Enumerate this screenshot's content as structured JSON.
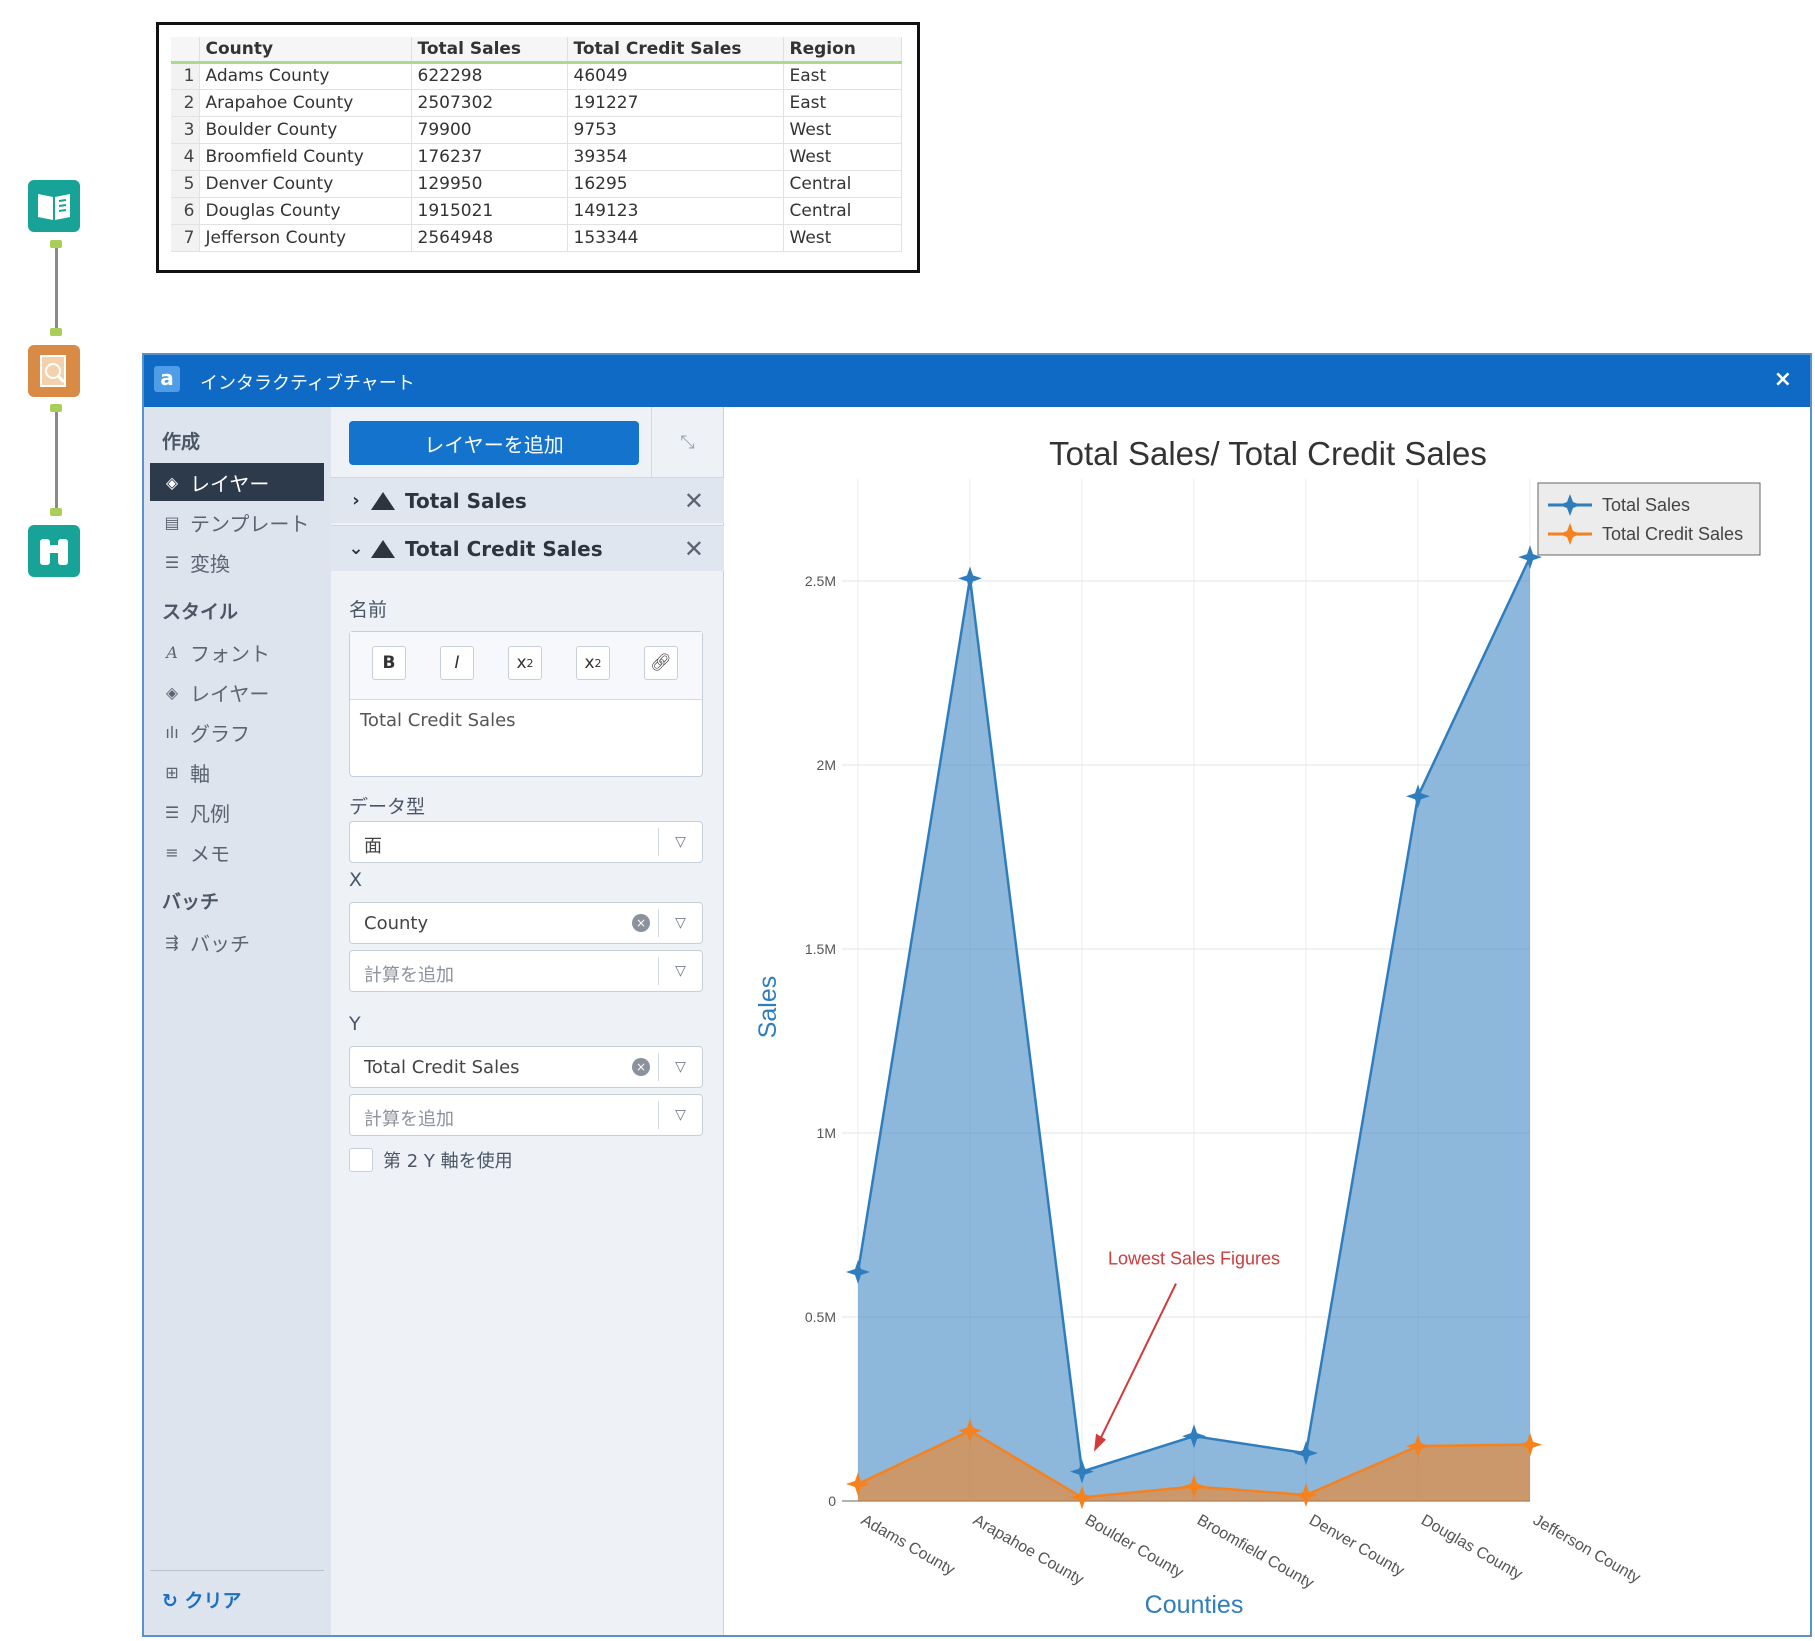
{
  "table": {
    "headers": [
      "County",
      "Total Sales",
      "Total Credit Sales",
      "Region"
    ],
    "rows": [
      {
        "n": "1",
        "county": "Adams County",
        "sales": "622298",
        "credit": "46049",
        "region": "East"
      },
      {
        "n": "2",
        "county": "Arapahoe County",
        "sales": "2507302",
        "credit": "191227",
        "region": "East"
      },
      {
        "n": "3",
        "county": "Boulder County",
        "sales": "79900",
        "credit": "9753",
        "region": "West"
      },
      {
        "n": "4",
        "county": "Broomfield County",
        "sales": "176237",
        "credit": "39354",
        "region": "West"
      },
      {
        "n": "5",
        "county": "Denver County",
        "sales": "129950",
        "credit": "16295",
        "region": "Central"
      },
      {
        "n": "6",
        "county": "Douglas County",
        "sales": "1915021",
        "credit": "149123",
        "region": "Central"
      },
      {
        "n": "7",
        "county": "Jefferson County",
        "sales": "2564948",
        "credit": "153344",
        "region": "West"
      }
    ]
  },
  "workflow": {
    "tools": [
      {
        "name": "input-data-tool",
        "color": "#17a398"
      },
      {
        "name": "interactive-chart-tool",
        "color": "#d98b45"
      },
      {
        "name": "browse-tool",
        "color": "#17a398"
      }
    ]
  },
  "dialog": {
    "logo": "a",
    "title": "インタラクティブチャート",
    "close": "×"
  },
  "nav": {
    "section_create": "作成",
    "create_items": [
      "レイヤー",
      "テンプレート",
      "変換"
    ],
    "section_style": "スタイル",
    "style_items": [
      "フォント",
      "レイヤー",
      "グラフ",
      "軸",
      "凡例",
      "メモ"
    ],
    "section_batch": "バッチ",
    "batch_items": [
      "バッチ"
    ],
    "clear": "クリア"
  },
  "panel": {
    "add_layer": "レイヤーを追加",
    "layers": [
      {
        "label": "Total Sales",
        "expanded": false
      },
      {
        "label": "Total Credit Sales",
        "expanded": true
      }
    ],
    "name_label": "名前",
    "name_value": "Total Credit Sales",
    "editor_buttons": [
      "B",
      "I",
      "X2",
      "X2",
      "link"
    ],
    "data_type_label": "データ型",
    "data_type_value": "面",
    "x_label": "X",
    "x_value": "County",
    "x_calc_placeholder": "計算を追加",
    "y_label": "Y",
    "y_value": "Total Credit Sales",
    "y_calc_placeholder": "計算を追加",
    "secondary_axis_label": "第 2 Y 軸を使用",
    "secondary_axis_checked": false
  },
  "chart_data": {
    "type": "area",
    "title": "Total Sales/ Total Credit Sales",
    "xlabel": "Counties",
    "ylabel": "Sales",
    "categories": [
      "Adams County",
      "Arapahoe County",
      "Boulder County",
      "Broomfield County",
      "Denver County",
      "Douglas County",
      "Jefferson County"
    ],
    "series": [
      {
        "name": "Total Sales",
        "color": "#2f7dbd",
        "values": [
          622298,
          2507302,
          79900,
          176237,
          129950,
          1915021,
          2564948
        ]
      },
      {
        "name": "Total Credit Sales",
        "color": "#f5821f",
        "values": [
          46049,
          191227,
          9753,
          39354,
          16295,
          149123,
          153344
        ]
      }
    ],
    "ylim": [
      0,
      2750000
    ],
    "yticks": [
      0,
      500000,
      1000000,
      1500000,
      2000000,
      2500000
    ],
    "ytick_labels": [
      "0",
      "0.5M",
      "1M",
      "1.5M",
      "2M",
      "2.5M"
    ],
    "grid": true,
    "legend_position": "top-right",
    "annotation": {
      "text": "Lowest Sales Figures",
      "category": "Boulder County",
      "color": "#d13b3b"
    }
  }
}
